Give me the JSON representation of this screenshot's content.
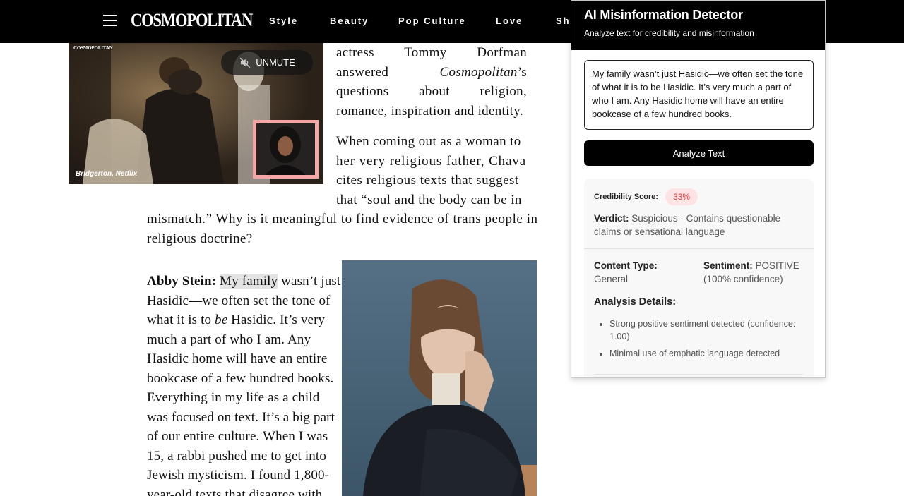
{
  "header": {
    "logo": "COSMOPOLITAN",
    "nav": [
      "Style",
      "Beauty",
      "Pop Culture",
      "Love",
      "Sho"
    ]
  },
  "video": {
    "mini_logo": "COSMOPOLITAN",
    "unmute_label": "UNMUTE",
    "caption": "Bridgerton, Netflix"
  },
  "article": {
    "intro_tail": [
      "actress Tommy Dorfman answered",
      "Cosmopolitan",
      "’s questions about religion, romance, inspiration and identity."
    ],
    "question_lines": [
      "When coming out as a woman to",
      "her very religious father, Chava",
      "cites religious texts that suggest",
      "that “soul and the body can be in",
      "mismatch.” Why is it meaningful to find evidence of trans people in",
      "religious doctrine?"
    ],
    "answer_speaker": "Abby Stein:",
    "answer_highlight": "My family",
    "answer_first_rest": "wasn’t just",
    "answer_lines": [
      "Hasidic—we often set the tone of",
      "much a part of who I am. Any",
      "Hasidic home will have an entire",
      "bookcase of a few hundred books.",
      "Everything in my life as a child",
      "was focused on text. It’s a big part",
      "of our entire culture. When I was",
      "15, a rabbi pushed me to get into",
      "Jewish mysticism. I found 1,800-",
      "year-old texts that disagree with"
    ],
    "answer_line3_pre": "what it is to ",
    "answer_line3_em": "be",
    "answer_line3_post": " Hasidic. It’s very"
  },
  "detector": {
    "title": "AI Misinformation Detector",
    "subtitle": "Analyze text for credibility and misinformation",
    "input_text": "My family wasn’t just Hasidic—we often set the tone of what it is to be Hasidic. It’s very much a part of who I am. Any Hasidic home will have an entire bookcase of a few hundred books.",
    "analyze_label": "Analyze Text",
    "score_label": "Credibility Score:",
    "score_value": "33%",
    "verdict_label": "Verdict:",
    "verdict_text": "Suspicious - Contains questionable claims or sensational language",
    "content_type_label": "Content Type:",
    "content_type_value": "General",
    "sentiment_label": "Sentiment:",
    "sentiment_value": "POSITIVE (100% confidence)",
    "details_title": "Analysis Details:",
    "details": [
      "Strong positive sentiment detected (confidence: 1.00)",
      "Minimal use of emphatic language detected"
    ]
  },
  "colors": {
    "header_bg": "#000000",
    "score_badge_bg": "#fde3e3",
    "score_badge_text": "#d94040",
    "pip_border": "#f2a6a6"
  }
}
